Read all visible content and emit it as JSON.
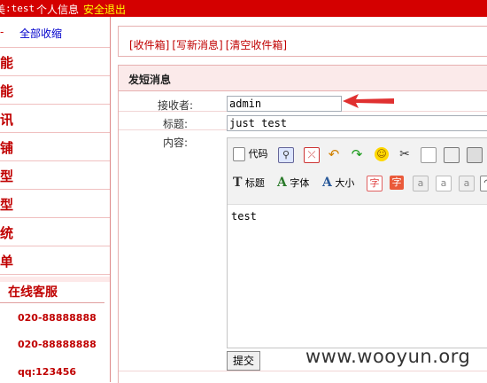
{
  "topbar": {
    "prefix": "美",
    "username": ":test",
    "profile_link": "个人信息",
    "logout_link": "安全退出"
  },
  "sidebar": {
    "collapse_marker": "-",
    "collapse_all": "全部收缩",
    "items": [
      "能",
      "能",
      "讯",
      "铺",
      "型",
      "型",
      "统",
      "单"
    ],
    "kefu_title": "在线客服",
    "kefu_items": [
      "020-88888888",
      "020-88888888",
      "qq:123456"
    ]
  },
  "tabs": {
    "inbox": "[收件箱]",
    "compose": "[写新消息]",
    "clear": "[清空收件箱]"
  },
  "form": {
    "title": "发短消息",
    "receiver_label": "接收者:",
    "receiver_value": "admin",
    "subject_label": "标题:",
    "subject_value": "just test",
    "content_label": "内容:",
    "content_value": "test",
    "submit_label": "提交"
  },
  "toolbar": {
    "code_label": "代码",
    "heading_label": "标题",
    "font_label": "字体",
    "size_label": "大小",
    "char_glyph": "字",
    "a_glyph": "a"
  },
  "watermark": "www.wooyun.org",
  "colors": {
    "topbar": "#d40000",
    "accent": "#c00000",
    "link": "#0000cc",
    "logout": "#ffff00"
  }
}
